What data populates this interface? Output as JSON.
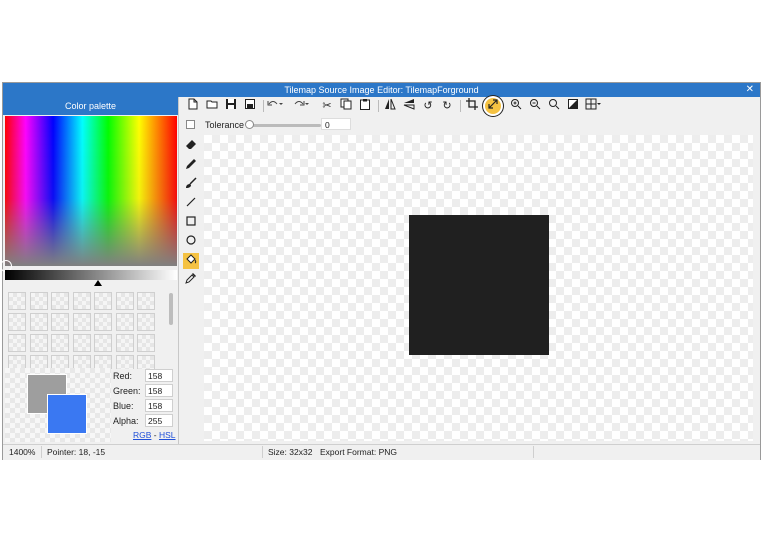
{
  "window": {
    "title": "Tilemap Source Image Editor: TilemapForground",
    "close_glyph": "✕"
  },
  "palette": {
    "header": "Color palette",
    "primary_color": "#9e9e9e",
    "secondary_color": "#3a78f2",
    "fields": [
      {
        "label": "Red:",
        "value": "158"
      },
      {
        "label": "Green:",
        "value": "158"
      },
      {
        "label": "Blue:",
        "value": "158"
      },
      {
        "label": "Alpha:",
        "value": "255"
      }
    ],
    "mode_rgb": "RGB",
    "mode_separator": " - ",
    "mode_hsl": "HSL"
  },
  "toolbar": {
    "icons": [
      "new-file-icon",
      "open-folder-icon",
      "save-icon",
      "export-icon",
      "undo-icon",
      "redo-icon",
      "cut-icon",
      "copy-icon",
      "paste-icon",
      "flip-horizontal-icon",
      "flip-vertical-icon",
      "rotate-left-icon",
      "rotate-right-icon",
      "crop-icon",
      "resize-icon",
      "zoom-in-icon",
      "zoom-out-icon",
      "zoom-fit-icon",
      "invert-colors-icon",
      "grid-icon"
    ]
  },
  "options": {
    "tolerance_label": "Tolerance",
    "tolerance_value": "0"
  },
  "tools": [
    "eraser-icon",
    "pencil-icon",
    "brush-icon",
    "line-icon",
    "rectangle-icon",
    "ellipse-icon",
    "fill-bucket-icon",
    "eyedropper-icon"
  ],
  "active_tool": "fill-bucket-icon",
  "canvas": {
    "sprite_color": "#202020"
  },
  "status": {
    "zoom": "1400%",
    "pointer": "Pointer: 18, -15",
    "size": "Size: 32x32",
    "export_format": "Export Format: PNG"
  }
}
